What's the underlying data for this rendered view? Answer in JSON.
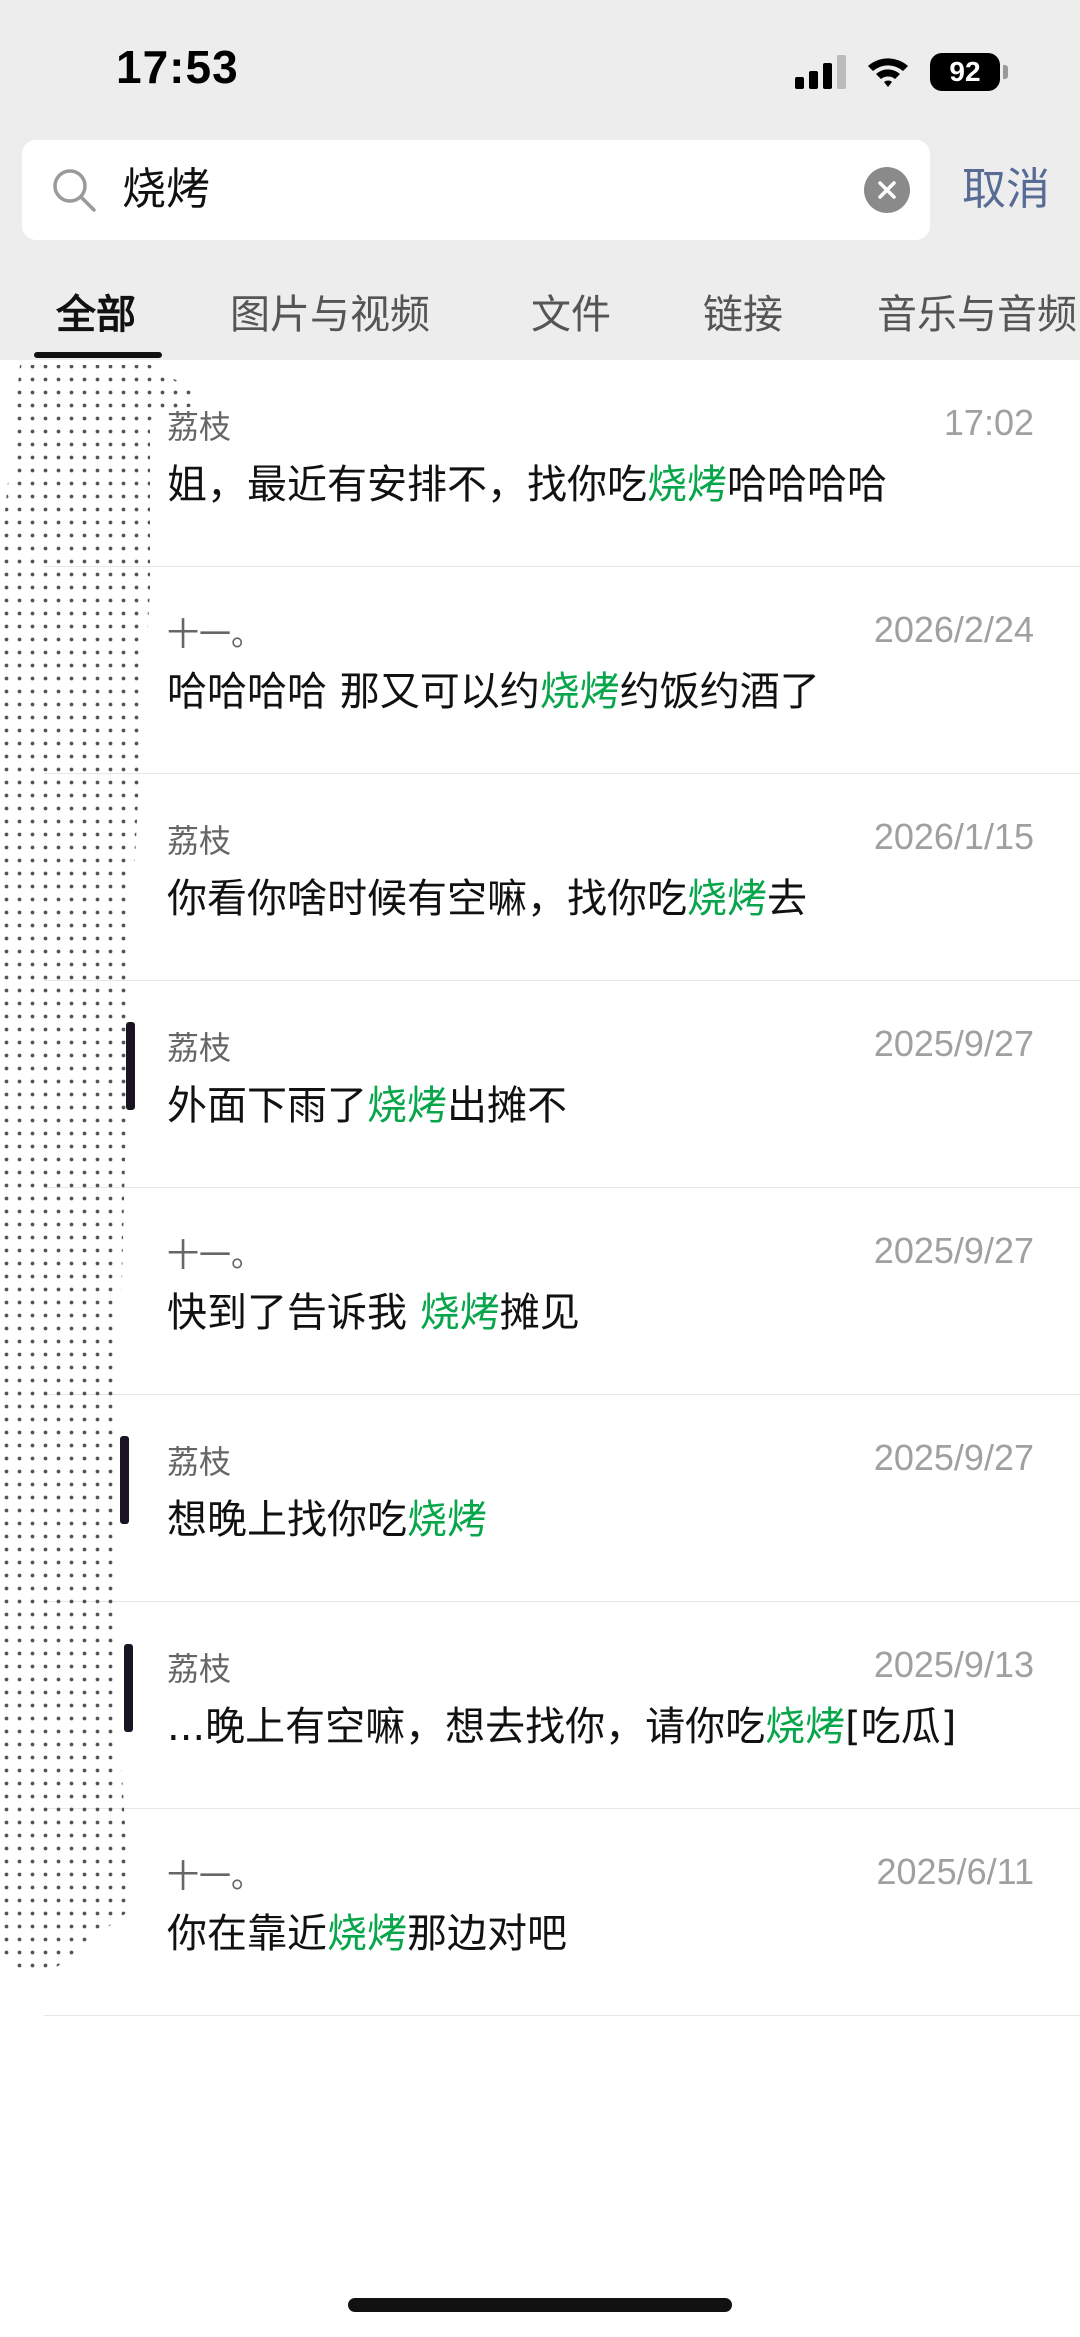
{
  "status_bar": {
    "time": "17:53",
    "battery": "92",
    "icons": [
      "signal-icon",
      "wifi-icon",
      "battery-icon"
    ]
  },
  "search": {
    "query": "烧烤",
    "cancel_label": "取消",
    "icons": [
      "search-icon",
      "clear-icon"
    ]
  },
  "tabs": [
    {
      "label": "全部",
      "active": true
    },
    {
      "label": "图片与视频",
      "active": false
    },
    {
      "label": "文件",
      "active": false
    },
    {
      "label": "链接",
      "active": false
    },
    {
      "label": "音乐与音频",
      "active": false
    }
  ],
  "results": [
    {
      "sender": "荔枝",
      "date": "17:02",
      "before": "姐，最近有安排不，找你吃",
      "keyword": "烧烤",
      "after": "哈哈哈哈"
    },
    {
      "sender": "十一。",
      "date": "2026/2/24",
      "before": "哈哈哈哈 那又可以约",
      "keyword": "烧烤",
      "after": "约饭约酒了"
    },
    {
      "sender": "荔枝",
      "date": "2026/1/15",
      "before": "你看你啥时候有空嘛，找你吃",
      "keyword": "烧烤",
      "after": "去"
    },
    {
      "sender": "荔枝",
      "date": "2025/9/27",
      "before": "外面下雨了",
      "keyword": "烧烤",
      "after": "出摊不"
    },
    {
      "sender": "十一。",
      "date": "2025/9/27",
      "before": "快到了告诉我 ",
      "keyword": "烧烤",
      "after": "摊见"
    },
    {
      "sender": "荔枝",
      "date": "2025/9/27",
      "before": "想晚上找你吃",
      "keyword": "烧烤",
      "after": ""
    },
    {
      "sender": "荔枝",
      "date": "2025/9/13",
      "before": "...晚上有空嘛，想去找你，请你吃",
      "keyword": "烧烤",
      "after": "[吃瓜]"
    },
    {
      "sender": "十一。",
      "date": "2025/6/11",
      "before": "你在靠近",
      "keyword": "烧烤",
      "after": "那边对吧"
    }
  ],
  "colors": {
    "highlight": "#07a64a",
    "link": "#576b95",
    "header_bg": "#ededed"
  }
}
